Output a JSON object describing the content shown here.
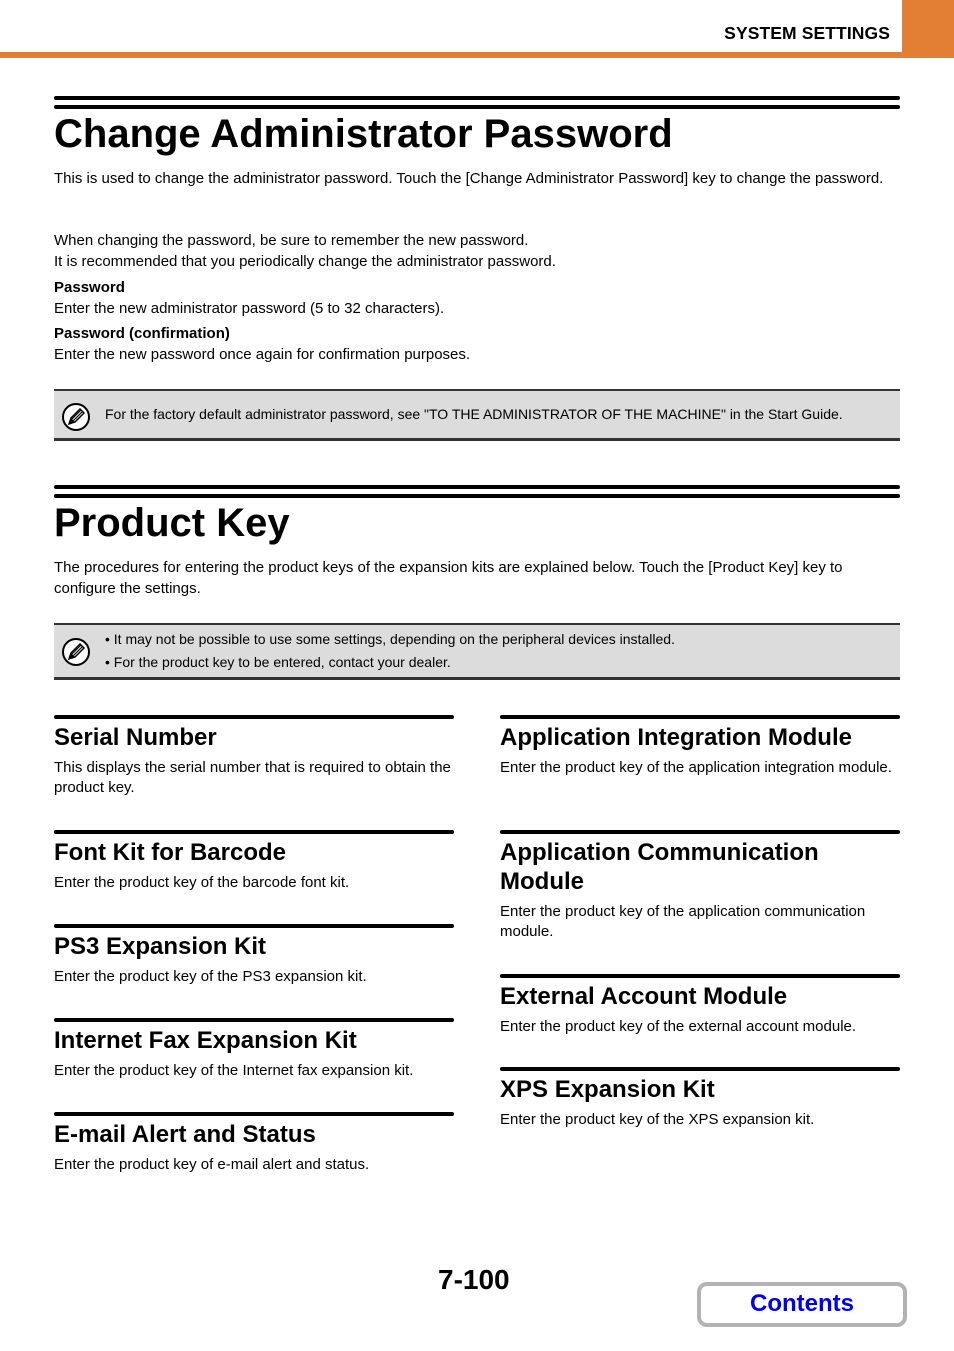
{
  "header": {
    "title": "SYSTEM SETTINGS",
    "accent_color": "#e27f34"
  },
  "admin_password": {
    "title": "Change Administrator Password",
    "intro": "This is used to change the administrator password. Touch the [Change Administrator Password] key to change the password.",
    "reminder_1": "When changing the password, be sure to remember the new password.",
    "reminder_2": "It is recommended that you periodically change the administrator password.",
    "fields": [
      {
        "label": "Password",
        "desc": "Enter the new administrator password (5 to 32 characters)."
      },
      {
        "label": "Password (confirmation)",
        "desc": "Enter the new password once again for confirmation purposes."
      }
    ],
    "note": {
      "icon": "pencil-note-icon",
      "text": "For the factory default administrator password, see \"TO THE ADMINISTRATOR OF THE MACHINE\" in the Start Guide."
    }
  },
  "product_key": {
    "title": "Product Key",
    "intro": "The procedures for entering the product keys of the expansion kits are explained below. Touch the [Product Key] key to configure the settings.",
    "note": {
      "icon": "pencil-note-icon",
      "bullets": [
        "• It may not be possible to use some settings, depending on the peripheral devices installed.",
        "• For the product key to be entered, contact your dealer."
      ]
    },
    "left_sections": [
      {
        "title": "Serial Number",
        "desc": "This displays the serial number that is required to obtain the product key."
      },
      {
        "title": "Font Kit for Barcode",
        "desc": "Enter the product key of the barcode font kit."
      },
      {
        "title": "PS3 Expansion Kit",
        "desc": "Enter the product key of the PS3 expansion kit."
      },
      {
        "title": "Internet Fax Expansion Kit",
        "desc": "Enter the product key of the Internet fax expansion kit."
      },
      {
        "title": "E-mail Alert and Status",
        "desc": "Enter the product key of e-mail alert and status."
      }
    ],
    "right_sections": [
      {
        "title": "Application Integration Module",
        "desc": "Enter the product key of the application integration module."
      },
      {
        "title": "Application Communication Module",
        "desc": "Enter the product key of the application communication module."
      },
      {
        "title": "External Account Module",
        "desc": "Enter the product key of the external account module."
      },
      {
        "title": "XPS Expansion Kit",
        "desc": "Enter the product key of the XPS expansion kit."
      }
    ]
  },
  "footer": {
    "page_number": "7-100",
    "contents_label": "Contents",
    "contents_color": "#0000ee"
  }
}
